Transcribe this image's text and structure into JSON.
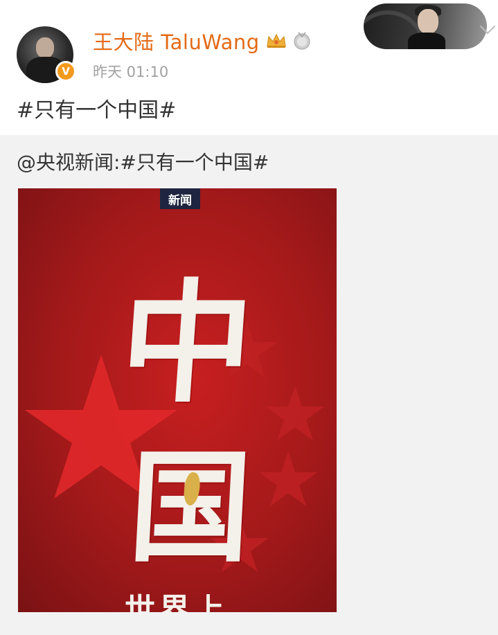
{
  "post": {
    "author_name": "王大陆 TaluWang",
    "verified_badge": "V",
    "timestamp": "昨天 01:10",
    "text": "#只有一个中国#",
    "icons": [
      "crown-icon",
      "medal-icon",
      "chevron-down-icon"
    ]
  },
  "repost": {
    "text": "@央视新闻:#只有一个中国#",
    "poster": {
      "tag": "新闻",
      "char_top": "中",
      "char_bottom": "国",
      "bottom_text": "世界上"
    }
  },
  "colors": {
    "name_orange": "#e36a16",
    "badge_orange": "#f39a1e",
    "poster_red": "#b01c1d",
    "repost_bg": "#f2f2f2"
  }
}
